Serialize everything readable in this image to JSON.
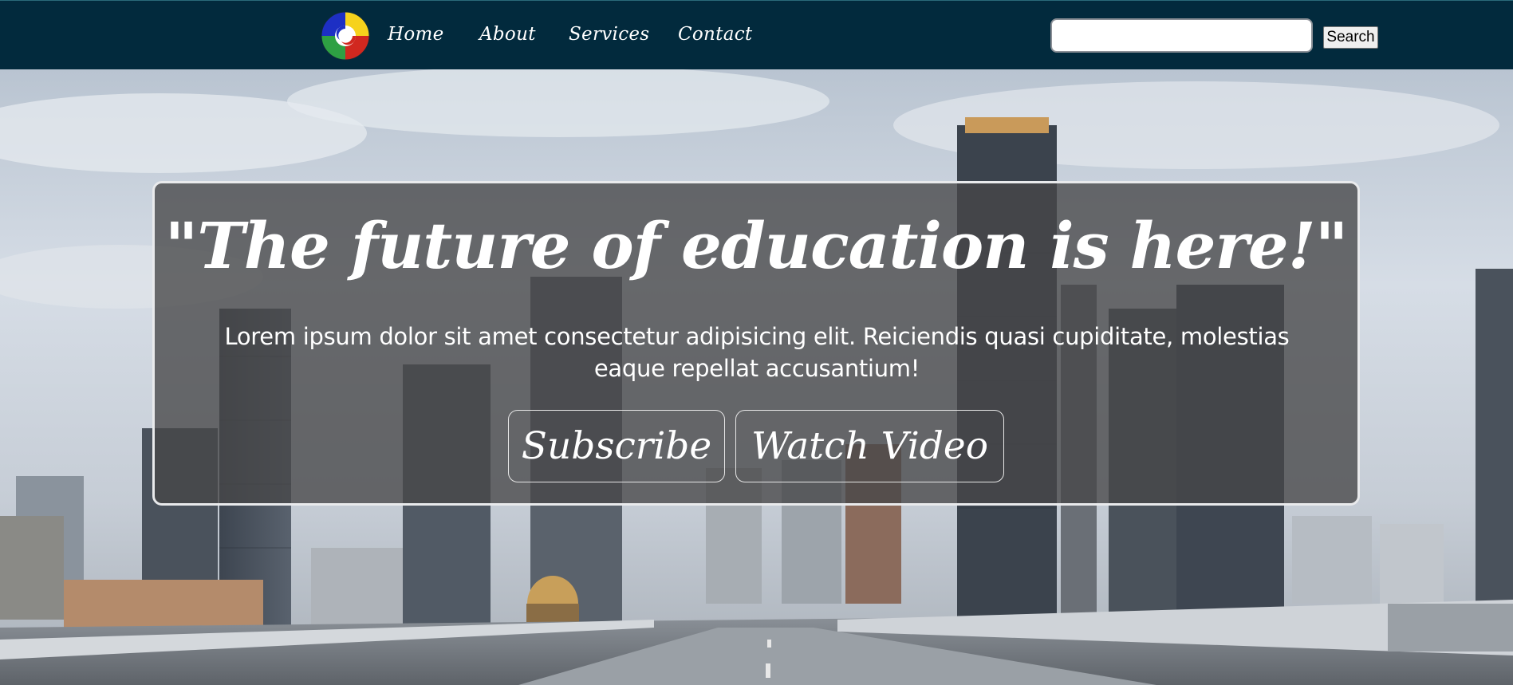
{
  "nav": {
    "links": [
      "Home",
      "About",
      "Services",
      "Contact"
    ],
    "search_placeholder": "",
    "search_button_label": "Search"
  },
  "hero": {
    "headline": "\"The future of education is here!\"",
    "lead": "Lorem ipsum dolor sit amet consectetur adipisicing elit. Reiciendis quasi cupiditate, molestias eaque repellat accusantium!",
    "buttons": {
      "subscribe": "Subscribe",
      "watch_video": "Watch Video"
    }
  },
  "theme": {
    "navbar_bg": "#022a3d",
    "card_bg": "rgba(70,70,72,0.78)",
    "text": "#ffffff"
  }
}
